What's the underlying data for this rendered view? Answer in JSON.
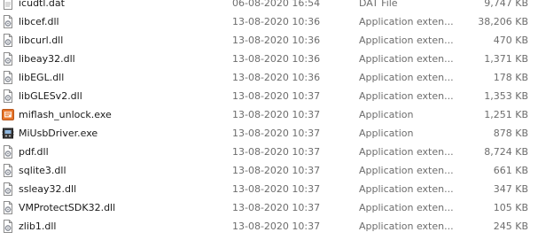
{
  "files": [
    {
      "name": "icudtl.dat",
      "date": "06-08-2020 16:54",
      "type": "DAT File",
      "size": "9,747 KB",
      "icon": "document-file-icon"
    },
    {
      "name": "libcef.dll",
      "date": "13-08-2020 10:36",
      "type": "Application exten...",
      "size": "38,206 KB",
      "icon": "dll-file-icon"
    },
    {
      "name": "libcurl.dll",
      "date": "13-08-2020 10:36",
      "type": "Application exten...",
      "size": "470 KB",
      "icon": "dll-file-icon"
    },
    {
      "name": "libeay32.dll",
      "date": "13-08-2020 10:36",
      "type": "Application exten...",
      "size": "1,371 KB",
      "icon": "dll-file-icon"
    },
    {
      "name": "libEGL.dll",
      "date": "13-08-2020 10:36",
      "type": "Application exten...",
      "size": "178 KB",
      "icon": "dll-file-icon"
    },
    {
      "name": "libGLESv2.dll",
      "date": "13-08-2020 10:37",
      "type": "Application exten...",
      "size": "1,353 KB",
      "icon": "dll-file-icon"
    },
    {
      "name": "miflash_unlock.exe",
      "date": "13-08-2020 10:37",
      "type": "Application",
      "size": "1,251 KB",
      "icon": "miflash-app-icon"
    },
    {
      "name": "MiUsbDriver.exe",
      "date": "13-08-2020 10:37",
      "type": "Application",
      "size": "878 KB",
      "icon": "usb-driver-app-icon"
    },
    {
      "name": "pdf.dll",
      "date": "13-08-2020 10:37",
      "type": "Application exten...",
      "size": "8,724 KB",
      "icon": "dll-file-icon"
    },
    {
      "name": "sqlite3.dll",
      "date": "13-08-2020 10:37",
      "type": "Application exten...",
      "size": "661 KB",
      "icon": "dll-file-icon"
    },
    {
      "name": "ssleay32.dll",
      "date": "13-08-2020 10:37",
      "type": "Application exten...",
      "size": "347 KB",
      "icon": "dll-file-icon"
    },
    {
      "name": "VMProtectSDK32.dll",
      "date": "13-08-2020 10:37",
      "type": "Application exten...",
      "size": "105 KB",
      "icon": "dll-file-icon"
    },
    {
      "name": "zlib1.dll",
      "date": "13-08-2020 10:37",
      "type": "Application exten...",
      "size": "245 KB",
      "icon": "dll-file-icon"
    }
  ],
  "colors": {
    "name_text": "#1a1a1a",
    "meta_text": "#6d6d6d",
    "miflash_icon": "#e8752b",
    "dll_gear": "#8a8f99"
  }
}
